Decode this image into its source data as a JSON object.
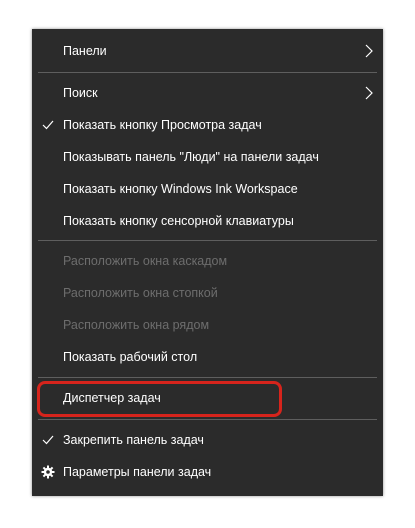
{
  "menu": {
    "items": [
      {
        "label": "Панели",
        "checked": false,
        "submenu": true,
        "disabled": false
      },
      {
        "label": "Поиск",
        "checked": false,
        "submenu": true,
        "disabled": false
      },
      {
        "label": "Показать кнопку Просмотра задач",
        "checked": true,
        "submenu": false,
        "disabled": false
      },
      {
        "label": "Показывать панель \"Люди\" на панели задач",
        "checked": false,
        "submenu": false,
        "disabled": false
      },
      {
        "label": "Показать кнопку Windows Ink Workspace",
        "checked": false,
        "submenu": false,
        "disabled": false
      },
      {
        "label": "Показать кнопку сенсорной клавиатуры",
        "checked": false,
        "submenu": false,
        "disabled": false
      },
      {
        "label": "Расположить окна каскадом",
        "checked": false,
        "submenu": false,
        "disabled": true
      },
      {
        "label": "Расположить окна стопкой",
        "checked": false,
        "submenu": false,
        "disabled": true
      },
      {
        "label": "Расположить окна рядом",
        "checked": false,
        "submenu": false,
        "disabled": true
      },
      {
        "label": "Показать рабочий стол",
        "checked": false,
        "submenu": false,
        "disabled": false
      },
      {
        "label": "Диспетчер задач",
        "checked": false,
        "submenu": false,
        "disabled": false,
        "highlighted": true
      },
      {
        "label": "Закрепить панель задач",
        "checked": true,
        "submenu": false,
        "disabled": false
      },
      {
        "label": "Параметры панели задач",
        "checked": false,
        "submenu": false,
        "disabled": false,
        "icon": "gear-icon"
      }
    ]
  },
  "colors": {
    "menu_background": "#2b2b2b",
    "text": "#ffffff",
    "disabled_text": "#6d6d6d",
    "separator": "#5e5e5e",
    "highlight_outline": "#d6241c"
  }
}
